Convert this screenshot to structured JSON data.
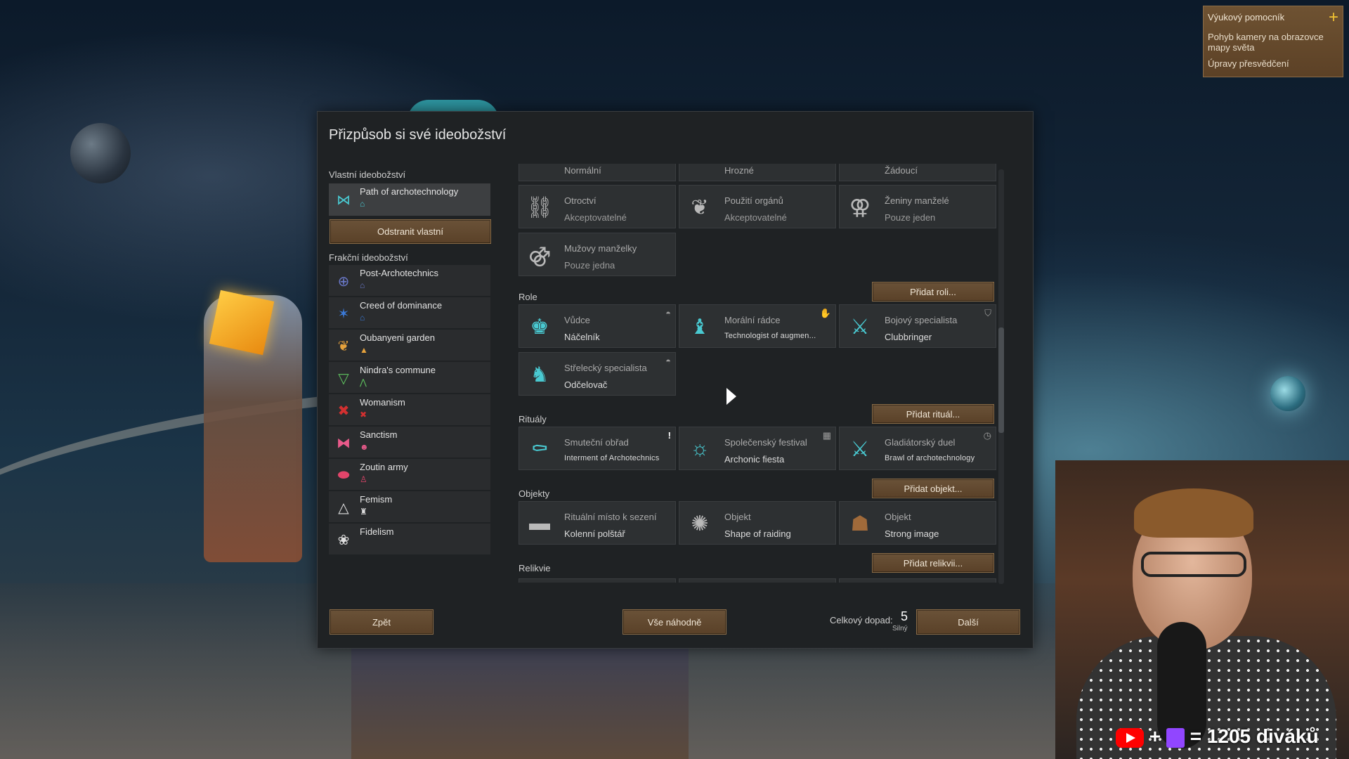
{
  "dialog": {
    "title": "Přizpůsob si své ideobožství",
    "own_section_label": "Vlastní ideobožství",
    "own_item": {
      "name": "Path of archotechnology",
      "icon": "butterfly-icon",
      "color": "#49c9d1"
    },
    "remove_button": "Odstranit vlastní",
    "faction_section_label": "Frakční ideobožství",
    "factions": [
      {
        "name": "Post-Archotechnics",
        "icon": "orb-icon",
        "color": "#6a78c8"
      },
      {
        "name": "Creed of dominance",
        "icon": "star-burst-icon",
        "color": "#3b7ad8"
      },
      {
        "name": "Oubanyeni garden",
        "icon": "leaf-icon",
        "color": "#e6a23c"
      },
      {
        "name": "Nindra's commune",
        "icon": "triangle-down-icon",
        "color": "#5fc25f"
      },
      {
        "name": "Womanism",
        "icon": "cross-icon",
        "color": "#d23030"
      },
      {
        "name": "Sanctism",
        "icon": "bow-icon",
        "color": "#e85a8a"
      },
      {
        "name": "Zoutin army",
        "icon": "drop-icon",
        "color": "#e2456a"
      },
      {
        "name": "Femism",
        "icon": "triangle-icon",
        "color": "#e0e0e0"
      },
      {
        "name": "Fidelism",
        "icon": "lotus-icon",
        "color": "#e0e0e0"
      }
    ]
  },
  "precepts_partial": [
    {
      "title": "Normální"
    },
    {
      "title": "Hrozné"
    },
    {
      "title": "Žádoucí"
    }
  ],
  "precepts": [
    {
      "title": "Otroctví",
      "value": "Akceptovatelné"
    },
    {
      "title": "Použití orgánů",
      "value": "Akceptovatelné"
    },
    {
      "title": "Ženiny manželé",
      "value": "Pouze jeden"
    },
    {
      "title": "Mužovy manželky",
      "value": "Pouze jedna"
    }
  ],
  "roles": {
    "label": "Role",
    "add_button": "Přidat roli...",
    "items": [
      {
        "title": "Vůdce",
        "value": "Náčelník"
      },
      {
        "title": "Morální rádce",
        "value": "Technologist of augmen..."
      },
      {
        "title": "Bojový specialista",
        "value": "Clubbringer"
      },
      {
        "title": "Střelecký specialista",
        "value": "Odčelovač"
      }
    ]
  },
  "rituals": {
    "label": "Rituály",
    "add_button": "Přidat rituál...",
    "items": [
      {
        "title": "Smuteční obřad",
        "value": "Interment of Archotechnics",
        "corner": "!"
      },
      {
        "title": "Společenský festival",
        "value": "Archonic fiesta",
        "corner": "▦"
      },
      {
        "title": "Gladiátorský duel",
        "value": "Brawl of archotechnology",
        "corner": "◷"
      }
    ]
  },
  "objects": {
    "label": "Objekty",
    "add_button": "Přidat objekt...",
    "items": [
      {
        "title": "Rituální místo k sezení",
        "value": "Kolenní polštář"
      },
      {
        "title": "Objekt",
        "value": "Shape of raiding"
      },
      {
        "title": "Objekt",
        "value": "Strong image"
      }
    ]
  },
  "relics": {
    "label": "Relikvie",
    "add_button": "Přidat relikvii..."
  },
  "bottom": {
    "back_button": "Zpět",
    "random_button": "Vše náhodně",
    "next_button": "Další",
    "impact_label": "Celkový dopad:",
    "impact_value": "5",
    "impact_strength": "Silný"
  },
  "tutor": {
    "title": "Výukový pomocník",
    "items": [
      "Pohyb kamery na obrazovce mapy světa",
      "Úpravy přesvědčení"
    ]
  },
  "stream": {
    "viewers_text": "= 1205 diváků",
    "plus": "+"
  },
  "colors": {
    "accent": "#49c9d1",
    "button": "#5a4128",
    "panel": "#1f2224"
  }
}
